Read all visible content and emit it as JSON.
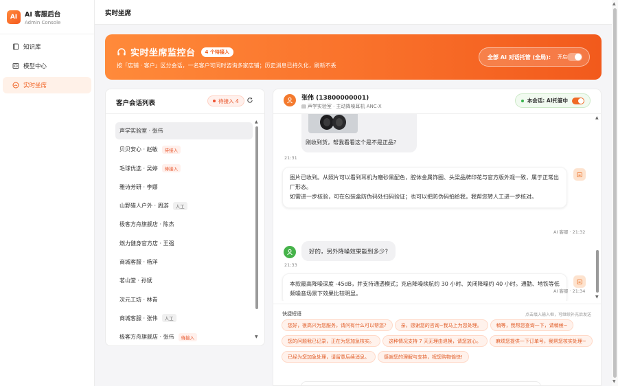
{
  "brand": {
    "logo": "AI",
    "title": "AI 客服后台",
    "subtitle": "Admin Console"
  },
  "sidebar": {
    "items": [
      {
        "label": "知识库",
        "icon": "book-icon",
        "active": false
      },
      {
        "label": "模型中心",
        "icon": "model-icon",
        "active": false
      },
      {
        "label": "实时坐席",
        "icon": "live-icon",
        "active": true
      }
    ]
  },
  "topbar": {
    "title": "实时坐席"
  },
  "banner": {
    "title": "实时坐席监控台",
    "pending_pill": "4 个待接入",
    "description": "按「店铺 · 客户」区分会话，一名客户可同时咨询多家店铺；历史消息已持久化，刷新不丢",
    "ai_toggle_label": "全部 AI 对话托管 (全局):",
    "ai_toggle_state": "开启"
  },
  "session_list": {
    "title": "客户会话列表",
    "waiting_badge": "待接入 4",
    "items": [
      {
        "label": "声学实验室 · 张伟",
        "tag": "",
        "tag_type": "",
        "active": true
      },
      {
        "label": "贝贝安心 · 赵敏",
        "tag": "待接入",
        "tag_type": "pending",
        "active": false
      },
      {
        "label": "毛球优选 · 吴婷",
        "tag": "待接入",
        "tag_type": "pending",
        "active": false
      },
      {
        "label": "雅诗芳研 · 李娜",
        "tag": "",
        "tag_type": "",
        "active": false
      },
      {
        "label": "山野猎人户外 · 周游",
        "tag": "人工",
        "tag_type": "human",
        "active": false
      },
      {
        "label": "极客方舟旗舰店 · 陈杰",
        "tag": "",
        "tag_type": "",
        "active": false
      },
      {
        "label": "燃力健身官方店 · 王强",
        "tag": "",
        "tag_type": "",
        "active": false
      },
      {
        "label": "商城客服 · 杨洋",
        "tag": "",
        "tag_type": "",
        "active": false
      },
      {
        "label": "茗山堂 · 孙斌",
        "tag": "",
        "tag_type": "",
        "active": false
      },
      {
        "label": "次元工坊 · 林青",
        "tag": "",
        "tag_type": "",
        "active": false
      },
      {
        "label": "商城客服 · 张伟",
        "tag": "人工",
        "tag_type": "human",
        "active": false
      },
      {
        "label": "极客方舟旗舰店 · 张伟",
        "tag": "待接入",
        "tag_type": "pending",
        "active": false
      }
    ]
  },
  "chat": {
    "name": "张伟 (13800000001)",
    "sub": "声学实验室 · 主动降噪耳机 ANC-X",
    "session_label": "本会话: AI托管中",
    "messages": {
      "m1_text": "刚收到货，帮我看看这个是不是正品?",
      "m1_time": "21:31",
      "m2_line1": "图片已收到。从照片可以看到耳机为磨砂黑配色，腔体金属饰圈、头梁品牌印花与官方版外观一致，属于正常出厂形态。",
      "m2_line2": "如需进一步核验，可在包装盒防伪码处扫码验证；也可以把防伪码拍给我，我帮您转人工进一步核对。",
      "m2_meta": "AI 客服 · 21:32",
      "m3_text": "好的，另外降噪效果能到多少?",
      "m3_time": "21:33",
      "m4_text": "本款最高降噪深度 -45dB，并支持通透模式；充启降噪续航约 30 小时、关闭降噪约 40 小时。通勤、地铁等低频噪音场景下效果比较明显。",
      "m4_meta": "AI 客服 · 21:34"
    }
  },
  "quick": {
    "title": "快捷短语",
    "hint": "点击填入输入框，可继续补充后发送",
    "phrases": [
      "您好，很高兴为您服务，请问有什么可以帮您?",
      "亲，感谢您的咨询~我马上为您处理。",
      "稍等，我帮您查询一下，请稍候~",
      "您的问题我已记录，正在为您加急核实。",
      "这种情况支持 7 天无理由退换，请您放心。",
      "麻烦您提供一下订单号，我帮您核实处理~",
      "已经为您加急处理，请留意后续消息。",
      "感谢您的理解与支持，祝您购物愉快!"
    ]
  },
  "colors": {
    "accent": "#f06a25",
    "accent_light": "#fff2ec",
    "ok": "#36b24a"
  }
}
